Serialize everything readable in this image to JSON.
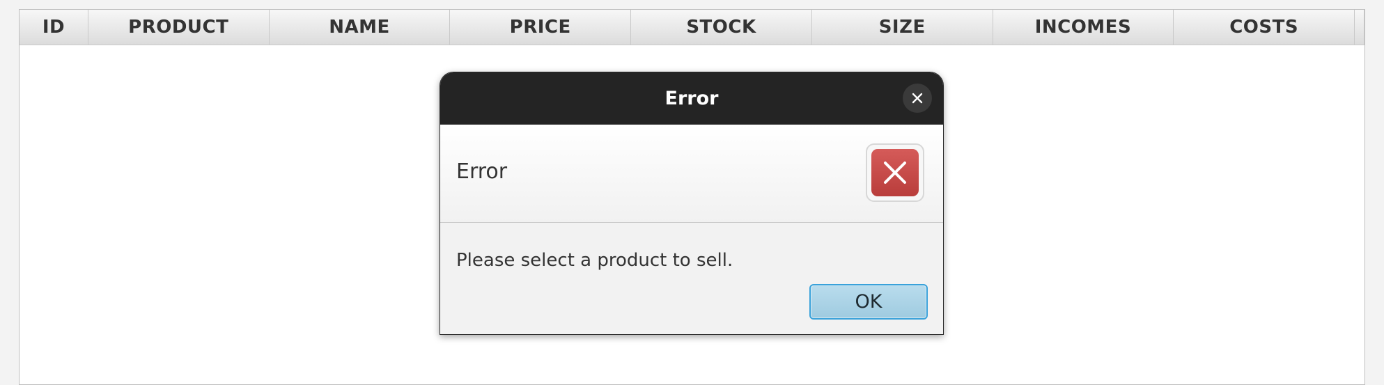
{
  "table": {
    "columns": [
      "ID",
      "PRODUCT",
      "NAME",
      "PRICE",
      "STOCK",
      "SIZE",
      "INCOMES",
      "COSTS"
    ]
  },
  "dialog": {
    "title": "Error",
    "header_text": "Error",
    "content_text": "Please select a product to sell.",
    "ok_label": "OK",
    "icons": {
      "close": "close-icon",
      "error": "error-x-icon"
    }
  },
  "colors": {
    "titlebar_bg": "#242424",
    "error_red": "#c94b49",
    "ok_button_bg": "#a8d2e6",
    "ok_button_border": "#3aa2da"
  }
}
